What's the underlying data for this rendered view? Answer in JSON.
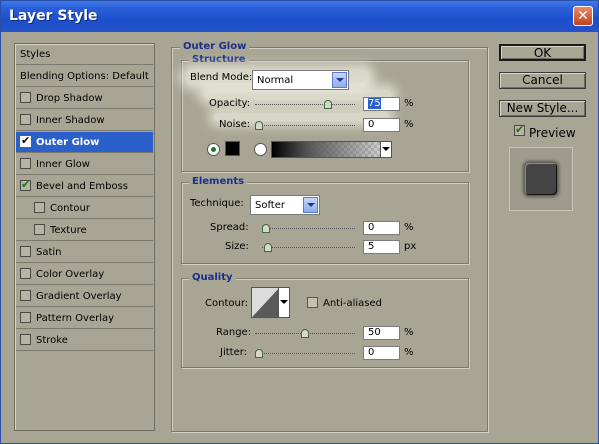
{
  "window": {
    "title": "Layer Style"
  },
  "list": {
    "items": [
      {
        "label": "Styles",
        "checkbox": false,
        "checked": false
      },
      {
        "label": "Blending Options: Default",
        "checkbox": false,
        "checked": false
      },
      {
        "label": "Drop Shadow",
        "checkbox": true,
        "checked": false
      },
      {
        "label": "Inner Shadow",
        "checkbox": true,
        "checked": false
      },
      {
        "label": "Outer Glow",
        "checkbox": true,
        "checked": true,
        "selected": true
      },
      {
        "label": "Inner Glow",
        "checkbox": true,
        "checked": false
      },
      {
        "label": "Bevel and Emboss",
        "checkbox": true,
        "checked": true
      },
      {
        "label": "Contour",
        "checkbox": true,
        "checked": false,
        "indent": true
      },
      {
        "label": "Texture",
        "checkbox": true,
        "checked": false,
        "indent": true
      },
      {
        "label": "Satin",
        "checkbox": true,
        "checked": false
      },
      {
        "label": "Color Overlay",
        "checkbox": true,
        "checked": false
      },
      {
        "label": "Gradient Overlay",
        "checkbox": true,
        "checked": false
      },
      {
        "label": "Pattern Overlay",
        "checkbox": true,
        "checked": false
      },
      {
        "label": "Stroke",
        "checkbox": true,
        "checked": false
      }
    ]
  },
  "outer_glow": {
    "title": "Outer Glow",
    "structure": {
      "title": "Structure",
      "blend_mode_label": "Blend Mode:",
      "blend_mode_value": "Normal",
      "opacity_label": "Opacity:",
      "opacity_value": "75",
      "opacity_unit": "%",
      "opacity_level": 0.75,
      "noise_label": "Noise:",
      "noise_value": "0",
      "noise_unit": "%",
      "noise_level": 0,
      "color": "#000000"
    },
    "elements": {
      "title": "Elements",
      "technique_label": "Technique:",
      "technique_value": "Softer",
      "spread_label": "Spread:",
      "spread_value": "0",
      "spread_unit": "%",
      "spread_level": 0,
      "size_label": "Size:",
      "size_value": "5",
      "size_unit": "px",
      "size_level": 0.02
    },
    "quality": {
      "title": "Quality",
      "contour_label": "Contour:",
      "anti_aliased_label": "Anti-aliased",
      "range_label": "Range:",
      "range_value": "50",
      "range_unit": "%",
      "range_level": 0.5,
      "jitter_label": "Jitter:",
      "jitter_value": "0",
      "jitter_unit": "%",
      "jitter_level": 0
    }
  },
  "buttons": {
    "ok": "OK",
    "cancel": "Cancel",
    "new_style": "New Style...",
    "preview_label": "Preview",
    "preview_checked": true
  },
  "colors": {
    "titlebar": "#2a5ed8",
    "selection": "#2b5fc9",
    "dialog_bg": "#a9a595",
    "group_title": "#1a2f8a"
  }
}
